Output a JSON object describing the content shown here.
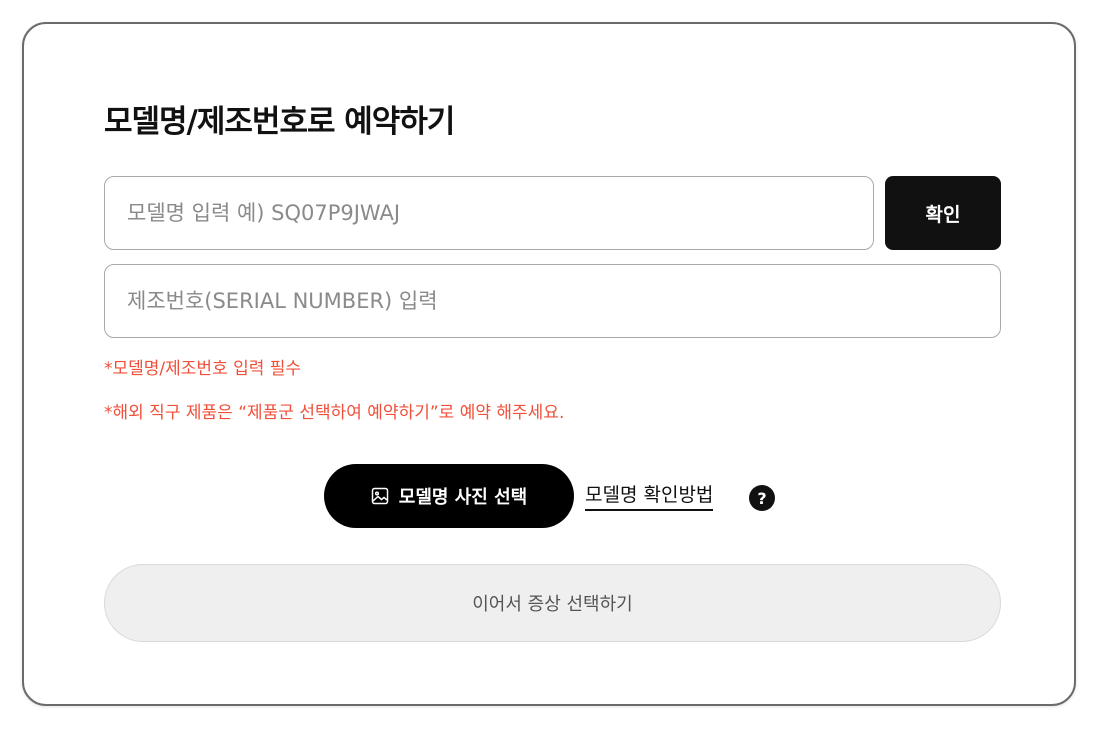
{
  "title": "모델명/제조번호로 예약하기",
  "model_input": {
    "value": "",
    "placeholder": "모델명 입력 예) SQ07P9JWAJ"
  },
  "confirm_button": "확인",
  "serial_input": {
    "value": "",
    "placeholder": "제조번호(SERIAL NUMBER) 입력"
  },
  "notices": [
    "*모델명/제조번호 입력 필수",
    "*해외 직구 제품은 “제품군 선택하여 예약하기”로 예약 해주세요."
  ],
  "photo_button": {
    "icon": "image-icon",
    "label": "모델명 사진 선택"
  },
  "help_link": {
    "label": "모델명 확인방법",
    "icon": "question-icon",
    "icon_glyph": "?"
  },
  "next_button": "이어서 증상 선택하기",
  "colors": {
    "notice": "#f0503a",
    "primary_button": "#111111",
    "disabled_button": "#efefef"
  }
}
